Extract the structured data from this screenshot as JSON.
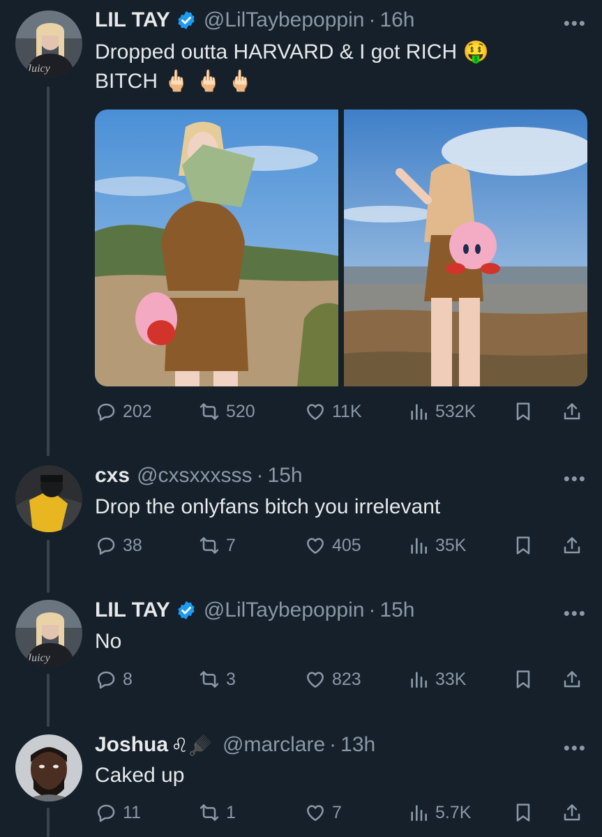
{
  "tweets": [
    {
      "name": "LIL TAY",
      "handle": "@LilTaybepoppin",
      "time": "16h",
      "verified": true,
      "text": "Dropped outta HARVARD & I got RICH 🤑\nBITCH 🖕🏻 🖕🏻 🖕🏻",
      "replies": "202",
      "reposts": "520",
      "likes": "11K",
      "views": "532K",
      "has_media": true
    },
    {
      "name": "cxs",
      "handle": "@cxsxxxsss",
      "time": "15h",
      "verified": false,
      "text": "Drop the onlyfans bitch you irrelevant",
      "replies": "38",
      "reposts": "7",
      "likes": "405",
      "views": "35K"
    },
    {
      "name": "LIL TAY",
      "handle": "@LilTaybepoppin",
      "time": "15h",
      "verified": true,
      "text": "No",
      "replies": "8",
      "reposts": "3",
      "likes": "823",
      "views": "33K"
    },
    {
      "name": "Joshua",
      "name_emoji": "♌🪮",
      "handle": "@marclare",
      "time": "13h",
      "verified": false,
      "text": "Caked up",
      "replies": "11",
      "reposts": "1",
      "likes": "7",
      "views": "5.7K"
    }
  ],
  "ui": {
    "separator": "·",
    "more": "•••"
  },
  "icons": {
    "reply": "reply-icon",
    "repost": "repost-icon",
    "like": "heart-icon",
    "views": "views-icon",
    "bookmark": "bookmark-icon",
    "share": "share-icon",
    "verified": "verified-badge-icon"
  },
  "colors": {
    "background": "#15202b",
    "text": "#e7e9ea",
    "muted": "#8b98a5",
    "verified": "#1d9bf0",
    "thread_line": "#38444d"
  }
}
